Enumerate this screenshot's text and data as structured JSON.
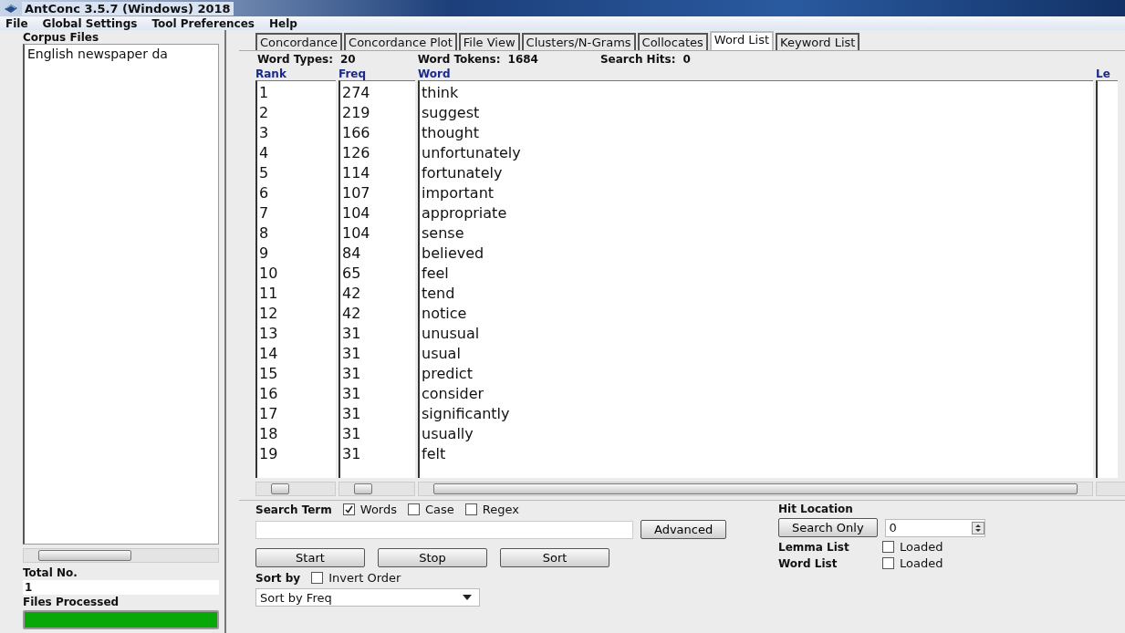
{
  "window": {
    "title": "AntConc 3.5.7 (Windows) 2018"
  },
  "menu": [
    "File",
    "Global Settings",
    "Tool Preferences",
    "Help"
  ],
  "sidebar": {
    "title": "Corpus Files",
    "files": [
      "English newspaper da"
    ],
    "total_label": "Total No.",
    "total_value": "1",
    "processed_label": "Files Processed",
    "progress": {
      "level": 1
    }
  },
  "tabs": [
    {
      "label": "Concordance",
      "selected": false
    },
    {
      "label": "Concordance Plot",
      "selected": false
    },
    {
      "label": "File View",
      "selected": false
    },
    {
      "label": "Clusters/N-Grams",
      "selected": false
    },
    {
      "label": "Collocates",
      "selected": false
    },
    {
      "label": "Word List",
      "selected": true
    },
    {
      "label": "Keyword List",
      "selected": false
    }
  ],
  "stats": [
    {
      "label": "Word Types:",
      "value": "20"
    },
    {
      "label": "Word Tokens:",
      "value": "1684"
    },
    {
      "label": "Search Hits:",
      "value": "0"
    }
  ],
  "table": {
    "columns": [
      "Rank",
      "Freq",
      "Word"
    ],
    "column_4": "Le",
    "rows": [
      [
        "1",
        "274",
        "think"
      ],
      [
        "2",
        "219",
        "suggest"
      ],
      [
        "3",
        "166",
        "thought"
      ],
      [
        "4",
        "126",
        "unfortunately"
      ],
      [
        "5",
        "114",
        "fortunately"
      ],
      [
        "6",
        "107",
        "important"
      ],
      [
        "7",
        "104",
        "appropriate"
      ],
      [
        "8",
        "104",
        "sense"
      ],
      [
        "9",
        "84",
        "believed"
      ],
      [
        "10",
        "65",
        "feel"
      ],
      [
        "11",
        "42",
        "tend"
      ],
      [
        "12",
        "42",
        "notice"
      ],
      [
        "13",
        "31",
        "unusual"
      ],
      [
        "14",
        "31",
        "usual"
      ],
      [
        "15",
        "31",
        "predict"
      ],
      [
        "16",
        "31",
        "consider"
      ],
      [
        "17",
        "31",
        "significantly"
      ],
      [
        "18",
        "31",
        "usually"
      ],
      [
        "19",
        "31",
        "felt"
      ]
    ]
  },
  "search": {
    "label": "Search Term",
    "options": [
      {
        "label": "Words",
        "checked": true
      },
      {
        "label": "Case",
        "checked": false
      },
      {
        "label": "Regex",
        "checked": false
      }
    ],
    "advanced": "Advanced"
  },
  "actions": [
    "Start",
    "Stop",
    "Sort"
  ],
  "sort": {
    "label": "Sort by",
    "invert": {
      "label": "Invert Order",
      "checked": false
    },
    "value": "Sort by Freq"
  },
  "hit_location": {
    "label": "Hit Location",
    "button": "Search Only",
    "value": "0"
  },
  "lists": [
    {
      "label": "Lemma List",
      "option": "Loaded",
      "checked": false
    },
    {
      "label": "Word List",
      "option": "Loaded",
      "checked": false
    }
  ]
}
